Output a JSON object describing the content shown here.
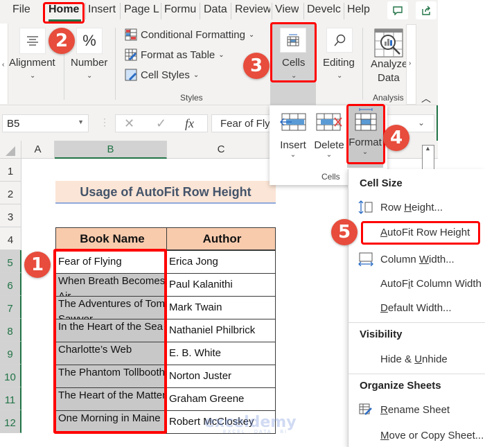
{
  "tabs": [
    {
      "label": "File"
    },
    {
      "label": "Home"
    },
    {
      "label": "Insert"
    },
    {
      "label": "Page L"
    },
    {
      "label": "Formu"
    },
    {
      "label": "Data"
    },
    {
      "label": "Review"
    },
    {
      "label": "View"
    },
    {
      "label": "Develc"
    },
    {
      "label": "Help"
    }
  ],
  "ribbon": {
    "alignment": "Alignment",
    "number": "Number",
    "number_icon": "%",
    "styles_items": [
      "Conditional Formatting",
      "Format as Table",
      "Cell Styles"
    ],
    "styles_group": "Styles",
    "cells": "Cells",
    "editing": "Editing",
    "analyze_line1": "Analyze",
    "analyze_line2": "Data",
    "analysis_group": "Analysis"
  },
  "formula_bar": {
    "name_box": "B5",
    "fx": "fx",
    "value": "Fear of Flying"
  },
  "columns": [
    "A",
    "B",
    "C"
  ],
  "rows": [
    "1",
    "2",
    "3",
    "4",
    "5",
    "6",
    "7",
    "8",
    "9",
    "10",
    "11",
    "12"
  ],
  "sheet": {
    "title": "Usage of AutoFit Row Height",
    "headers": [
      "Book Name",
      "Author"
    ],
    "books": [
      {
        "book": "Fear of Flying",
        "author": "Erica Jong"
      },
      {
        "book": "When Breath Becomes Air",
        "author": "Paul Kalanithi"
      },
      {
        "book": "The Adventures of Tom Sawyer",
        "author": "Mark Twain"
      },
      {
        "book": "In the Heart of the Sea",
        "author": "Nathaniel Philbrick"
      },
      {
        "book": "Charlotte’s Web",
        "author": "E. B. White"
      },
      {
        "book": "The Phantom Tollbooth",
        "author": "Norton Juster"
      },
      {
        "book": "The Heart of the Matter",
        "author": "Graham Greene"
      },
      {
        "book": "One Morning in Maine",
        "author": "Robert McCloskey"
      }
    ]
  },
  "cells_dropdown": {
    "items": [
      "Insert",
      "Delete",
      "Format"
    ],
    "group": "Cells"
  },
  "format_menu": {
    "sections": [
      "Cell Size",
      "Visibility",
      "Organize Sheets"
    ],
    "items": [
      {
        "pre": "Row ",
        "u": "H",
        "post": "eight..."
      },
      {
        "pre": "",
        "u": "A",
        "post": "utoFit Row Height"
      },
      {
        "pre": "Column ",
        "u": "W",
        "post": "idth..."
      },
      {
        "pre": "AutoF",
        "u": "i",
        "post": "t Column Width"
      },
      {
        "pre": "",
        "u": "D",
        "post": "efault Width..."
      },
      {
        "pre": "Hide & ",
        "u": "U",
        "post": "nhide"
      },
      {
        "pre": "",
        "u": "R",
        "post": "ename Sheet"
      },
      {
        "pre": "",
        "u": "M",
        "post": "ove or Copy Sheet..."
      }
    ]
  },
  "badges": [
    "1",
    "2",
    "3",
    "4",
    "5"
  ],
  "watermark": {
    "brand": "exceldemy",
    "tagline": "EXCEL · DATA · BI"
  },
  "colors": {
    "excel_green": "#217346",
    "highlight_red": "#ff0000",
    "badge_red": "#e74c3c",
    "header_fill": "#f8cbad",
    "title_fill": "#fbe5d6"
  }
}
